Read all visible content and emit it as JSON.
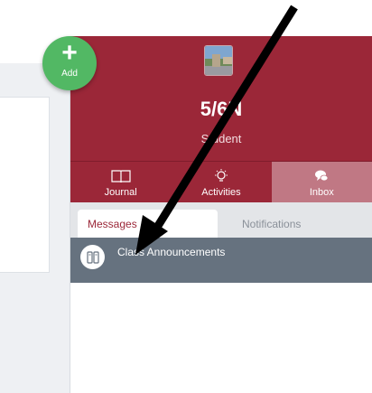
{
  "add_button": {
    "label": "Add"
  },
  "header": {
    "class_name": "5/6N",
    "role": "Student"
  },
  "nav": {
    "items": [
      {
        "label": "Journal",
        "icon": "book-icon"
      },
      {
        "label": "Activities",
        "icon": "lightbulb-icon"
      },
      {
        "label": "Inbox",
        "icon": "chat-bubbles-icon"
      }
    ],
    "active": "Inbox"
  },
  "tabs": {
    "messages": "Messages",
    "notifications": "Notifications",
    "active": "Messages"
  },
  "messages": [
    {
      "title": "Class Announcements",
      "icon": "book-icon"
    }
  ],
  "colors": {
    "brand": "#9b2738",
    "active_nav": "#c07884",
    "add": "#52b864",
    "row": "#66727f"
  }
}
